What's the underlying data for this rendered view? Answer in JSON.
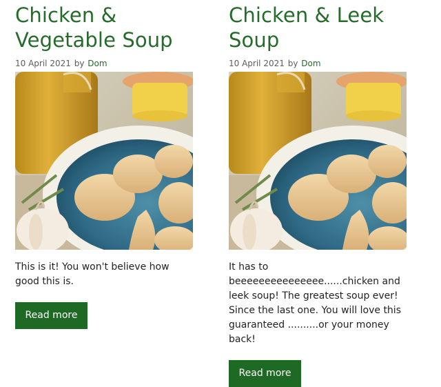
{
  "posts": [
    {
      "title_line1": "Chicken &",
      "title_line2": "Vegetable Soup",
      "date": "10 April 2021",
      "by": "by",
      "author": "Dom",
      "excerpt": "This is it! You won't believe how good this is.",
      "read_more": "Read more",
      "image_icon": "chicken-soup-photo"
    },
    {
      "title_line1": "Chicken & Leek",
      "title_line2": "Soup",
      "date": "10 April 2021",
      "by": "by",
      "author": "Dom",
      "excerpt": "It has to beeeeeeeeeeeeeee......chicken and leek soup! The greatest soup ever! Since the last one. You will love this guaranteed ..........or your money back!",
      "read_more": "Read more",
      "image_icon": "chicken-soup-photo"
    }
  ],
  "colors": {
    "accent": "#256b2a",
    "button": "#1e6a24",
    "text": "#222222",
    "meta": "#5c5c5c"
  }
}
